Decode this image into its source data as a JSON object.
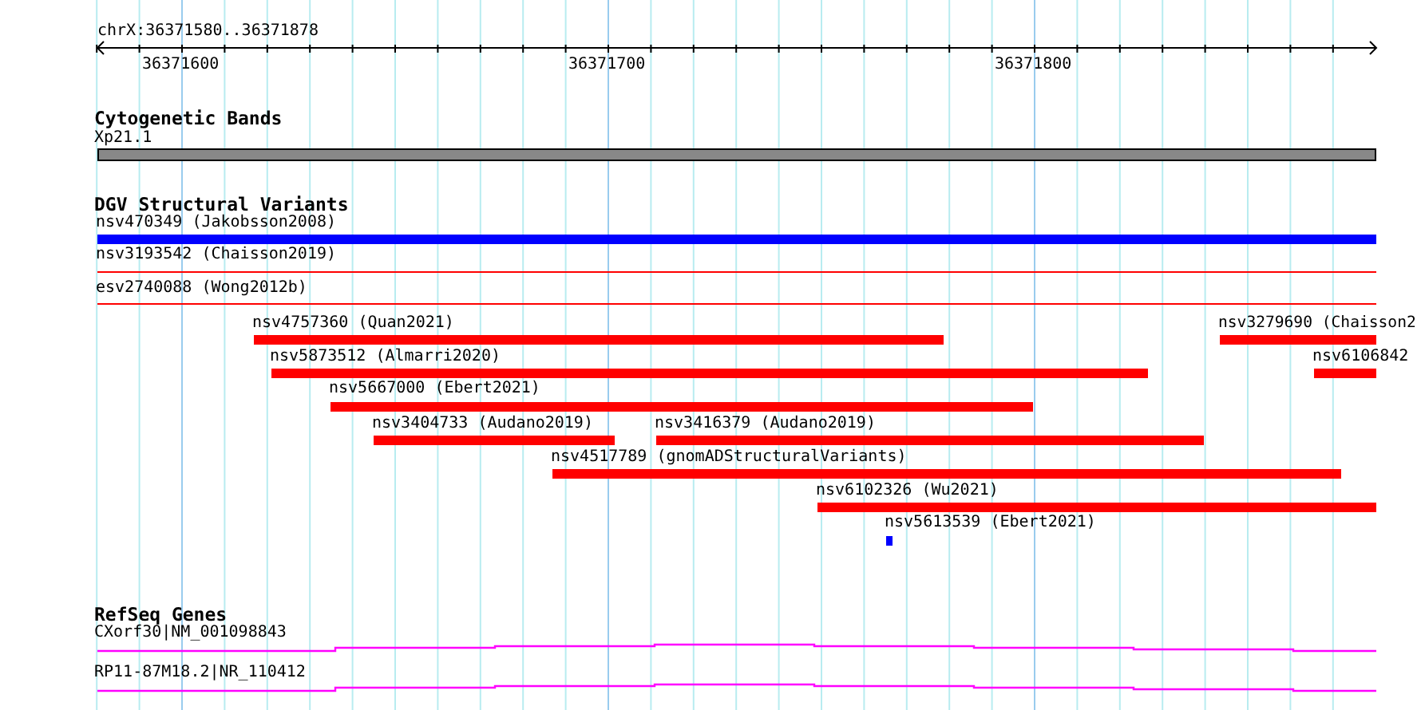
{
  "ruler": {
    "range": "chrX:36371580..36371878",
    "ticks": [
      "36371600",
      "36371700",
      "36371800"
    ]
  },
  "tracks": [
    {
      "title": "Cytogenetic Bands",
      "kind": "bands",
      "features": [
        {
          "label": "Xp21.1"
        }
      ]
    },
    {
      "title": "DGV Structural Variants",
      "kind": "variants",
      "features": [
        {
          "label": "nsv470349 (Jakobsson2008)",
          "kind": "bar",
          "color": "#0000ff"
        },
        {
          "label": "nsv3193542 (Chaisson2019)",
          "kind": "line",
          "color": "#ff0000"
        },
        {
          "label": "esv2740088 (Wong2012b)",
          "kind": "line",
          "color": "#ff0000"
        },
        {
          "label": "nsv4757360 (Quan2021)",
          "kind": "bar",
          "color": "#ff0000"
        },
        {
          "label": "nsv3279690 (Chaisson2",
          "kind": "bar",
          "color": "#ff0000"
        },
        {
          "label": "nsv5873512 (Almarri2020)",
          "kind": "bar",
          "color": "#ff0000"
        },
        {
          "label": "nsv6106842",
          "kind": "bar",
          "color": "#ff0000"
        },
        {
          "label": "nsv5667000 (Ebert2021)",
          "kind": "bar",
          "color": "#ff0000"
        },
        {
          "label": "nsv3404733 (Audano2019)",
          "kind": "bar",
          "color": "#ff0000"
        },
        {
          "label": "nsv3416379 (Audano2019)",
          "kind": "bar",
          "color": "#ff0000"
        },
        {
          "label": "nsv4517789 (gnomADStructuralVariants)",
          "kind": "bar",
          "color": "#ff0000"
        },
        {
          "label": "nsv6102326 (Wu2021)",
          "kind": "bar",
          "color": "#ff0000"
        },
        {
          "label": "nsv5613539 (Ebert2021)",
          "kind": "bar",
          "color": "#0000ff"
        }
      ]
    },
    {
      "title": "RefSeq Genes",
      "kind": "genes",
      "features": [
        {
          "label": "CXorf30|NM_001098843"
        },
        {
          "label": "RP11-87M18.2|NR_110412"
        }
      ]
    }
  ]
}
